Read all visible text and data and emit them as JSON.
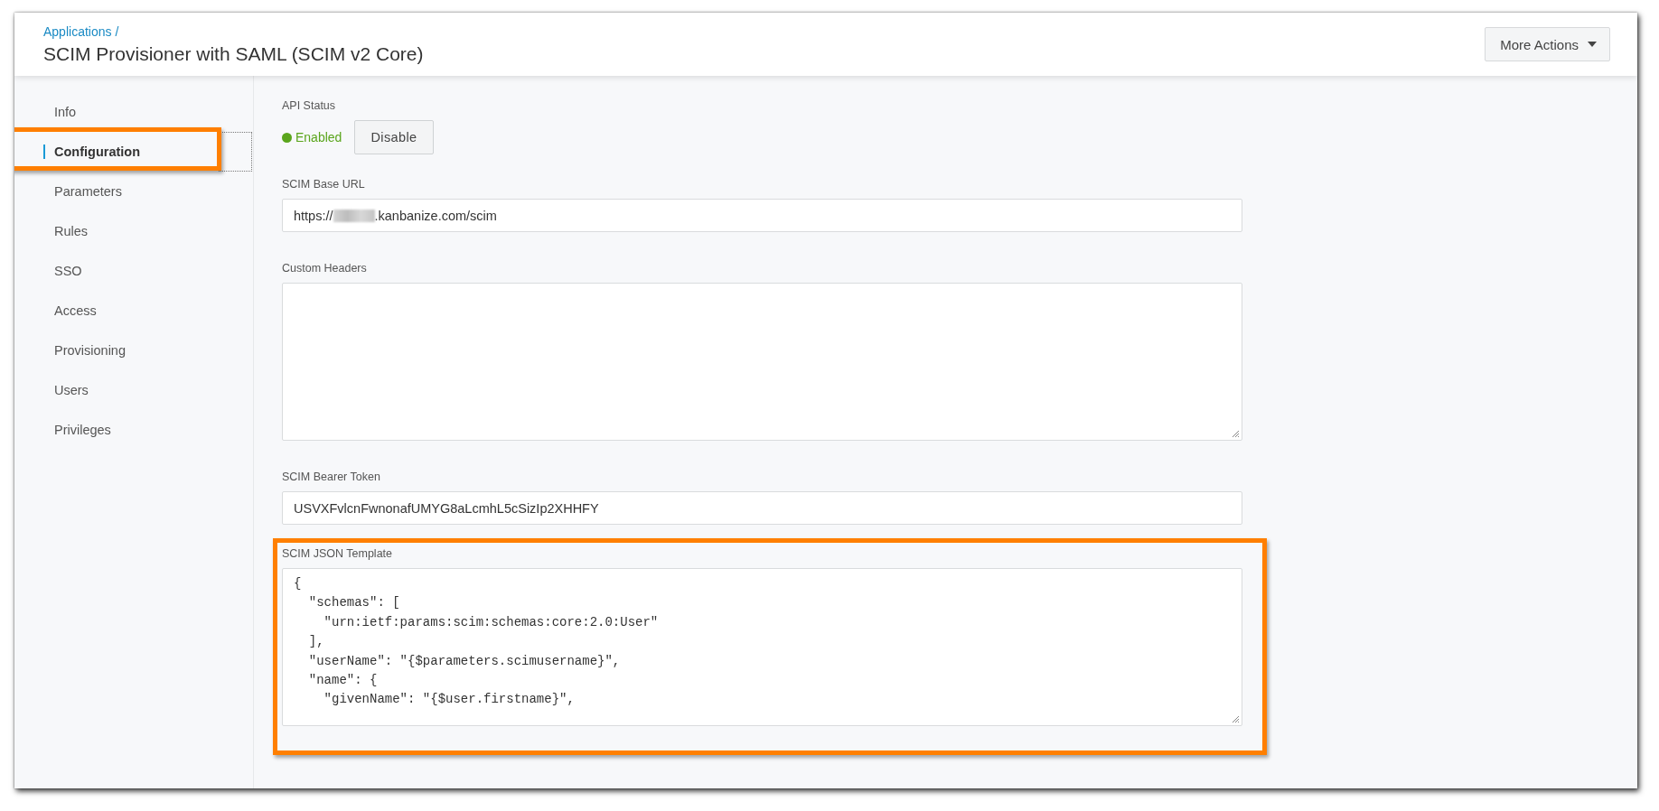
{
  "header": {
    "breadcrumb": "Applications /",
    "title": "SCIM Provisioner with SAML (SCIM v2 Core)",
    "actions_button": "More Actions"
  },
  "sidebar": {
    "items": [
      {
        "label": "Info",
        "selected": false,
        "highlighted": false
      },
      {
        "label": "Configuration",
        "selected": true,
        "highlighted": true
      },
      {
        "label": "Parameters",
        "selected": false,
        "highlighted": false
      },
      {
        "label": "Rules",
        "selected": false,
        "highlighted": false
      },
      {
        "label": "SSO",
        "selected": false,
        "highlighted": false
      },
      {
        "label": "Access",
        "selected": false,
        "highlighted": false
      },
      {
        "label": "Provisioning",
        "selected": false,
        "highlighted": false
      },
      {
        "label": "Users",
        "selected": false,
        "highlighted": false
      },
      {
        "label": "Privileges",
        "selected": false,
        "highlighted": false
      }
    ]
  },
  "api_status": {
    "label": "API Status",
    "status": "Enabled",
    "on": true,
    "button": "Disable"
  },
  "base_url": {
    "label": "SCIM Base URL",
    "value_start": "https://",
    "redacted": true,
    "value_end": ".kanbanize.com/scim"
  },
  "custom_headers": {
    "label": "Custom Headers"
  },
  "bearer_token": {
    "label": "SCIM Bearer Token",
    "value": "USVXFvlcnFwnonafUMYG8aLcmhL5cSizIp2XHHFY"
  },
  "json_template": {
    "label": "SCIM JSON Template",
    "highlighted": true,
    "lines": [
      "{",
      "  \"schemas\": [",
      "    \"urn:ietf:params:scim:schemas:core:2.0:User\"",
      "  ],",
      "  \"userName\": \"{$parameters.scimusername}\",",
      "  \"name\": {",
      "    \"givenName\": \"{$user.firstname}\","
    ]
  }
}
